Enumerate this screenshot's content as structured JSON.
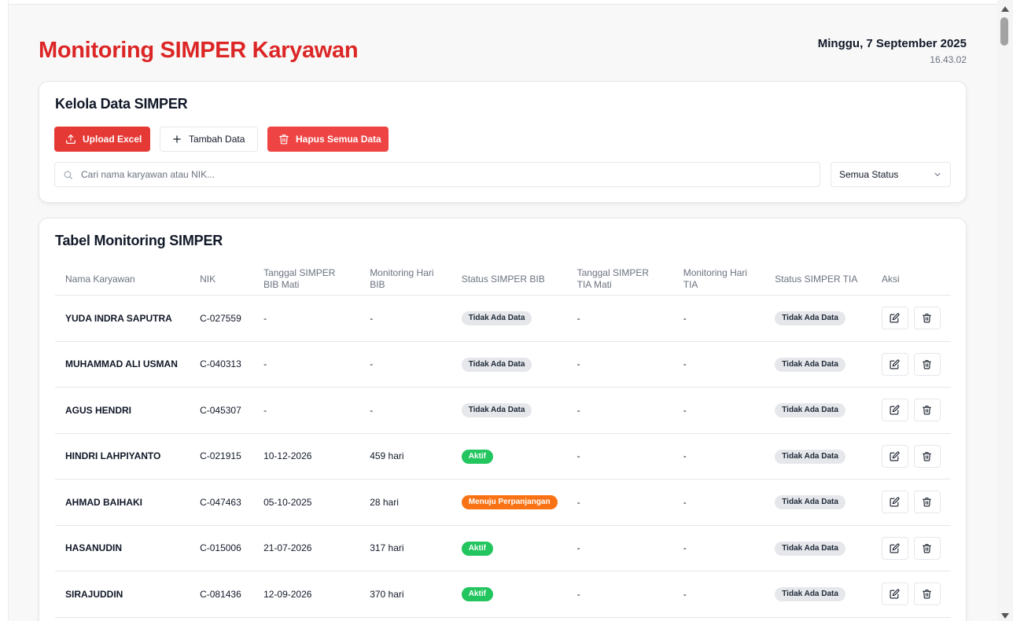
{
  "header": {
    "title": "Monitoring SIMPER Karyawan",
    "date": "Minggu, 7 September 2025",
    "time": "16.43.02"
  },
  "manage": {
    "title": "Kelola Data SIMPER",
    "upload_label": "Upload Excel",
    "add_label": "Tambah Data",
    "delete_all_label": "Hapus Semua Data",
    "search_placeholder": "Cari nama karyawan atau NIK...",
    "status_filter": "Semua Status"
  },
  "table": {
    "title": "Tabel Monitoring SIMPER",
    "columns": [
      "Nama Karyawan",
      "NIK",
      "Tanggal SIMPER BIB Mati",
      "Monitoring Hari BIB",
      "Status SIMPER BIB",
      "Tanggal SIMPER TIA Mati",
      "Monitoring Hari TIA",
      "Status SIMPER TIA",
      "Aksi"
    ],
    "rows": [
      {
        "name": "YUDA INDRA SAPUTRA",
        "nik": "C-027559",
        "bib_date": "-",
        "bib_days": "-",
        "bib_status": "Tidak Ada Data",
        "tia_date": "-",
        "tia_days": "-",
        "tia_status": "Tidak Ada Data"
      },
      {
        "name": "MUHAMMAD ALI USMAN",
        "nik": "C-040313",
        "bib_date": "-",
        "bib_days": "-",
        "bib_status": "Tidak Ada Data",
        "tia_date": "-",
        "tia_days": "-",
        "tia_status": "Tidak Ada Data"
      },
      {
        "name": "AGUS HENDRI",
        "nik": "C-045307",
        "bib_date": "-",
        "bib_days": "-",
        "bib_status": "Tidak Ada Data",
        "tia_date": "-",
        "tia_days": "-",
        "tia_status": "Tidak Ada Data"
      },
      {
        "name": "HINDRI LAHPIYANTO",
        "nik": "C-021915",
        "bib_date": "10-12-2026",
        "bib_days": "459 hari",
        "bib_status": "Aktif",
        "tia_date": "-",
        "tia_days": "-",
        "tia_status": "Tidak Ada Data"
      },
      {
        "name": "AHMAD BAIHAKI",
        "nik": "C-047463",
        "bib_date": "05-10-2025",
        "bib_days": "28 hari",
        "bib_status": "Menuju Perpanjangan",
        "tia_date": "-",
        "tia_days": "-",
        "tia_status": "Tidak Ada Data"
      },
      {
        "name": "HASANUDIN",
        "nik": "C-015006",
        "bib_date": "21-07-2026",
        "bib_days": "317 hari",
        "bib_status": "Aktif",
        "tia_date": "-",
        "tia_days": "-",
        "tia_status": "Tidak Ada Data"
      },
      {
        "name": "SIRAJUDDIN",
        "nik": "C-081436",
        "bib_date": "12-09-2026",
        "bib_days": "370 hari",
        "bib_status": "Aktif",
        "tia_date": "-",
        "tia_days": "-",
        "tia_status": "Tidak Ada Data"
      }
    ]
  },
  "colors": {
    "title": "#dc2626",
    "primary_button": "#e53935",
    "danger_button": "#ef4444",
    "status_active": "#22c55e",
    "status_renewal": "#f97316",
    "status_none": "#e5e7eb"
  },
  "icons": {
    "upload": "upload-icon",
    "add": "plus-icon",
    "delete_all": "trash-icon",
    "search": "search-icon",
    "dropdown": "chevron-down-icon",
    "edit": "edit-icon",
    "delete": "trash-icon"
  }
}
